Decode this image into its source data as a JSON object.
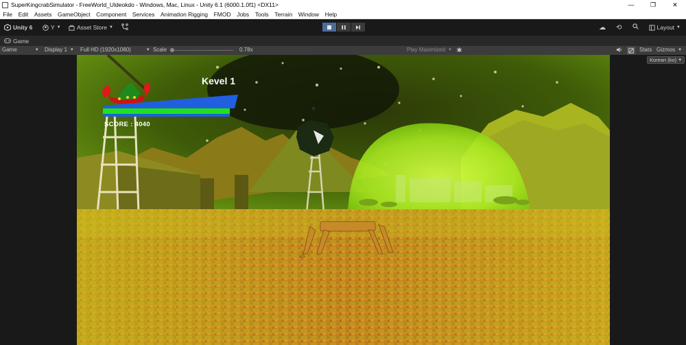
{
  "window": {
    "title": "SuperKingcrabSimulator - FreeWorld_Uldeokdo - Windows, Mac, Linux - Unity 6.1 (6000.1.0f1) <DX11>",
    "controls": {
      "minimize": "—",
      "maximize": "❐",
      "close": "✕"
    }
  },
  "menu": {
    "items": [
      "File",
      "Edit",
      "Assets",
      "GameObject",
      "Component",
      "Services",
      "Animation Rigging",
      "FMOD",
      "Jobs",
      "Tools",
      "Terrain",
      "Window",
      "Help"
    ]
  },
  "toolbar": {
    "unity_label": "Unity 6",
    "account_label": "Y",
    "asset_store_label": "Asset Store",
    "layout_label": "Layout"
  },
  "tab": {
    "label": "Game"
  },
  "gamebar": {
    "view_mode": "Game",
    "display": "Display 1",
    "resolution": "Full HD (1920x1080)",
    "scale_label": "Scale",
    "scale_value": "0.78x",
    "scale_fraction": 0.0,
    "play_mode": "Play Maximized",
    "stats_label": "Stats",
    "gizmos_label": "Gizmos"
  },
  "language_dropdown": {
    "value": "Korean (ko)"
  },
  "hud": {
    "level_text": "Kevel 1",
    "score_text": "SCORE : 4040"
  },
  "colors": {
    "editor_bg": "#191919",
    "toolbar_bg": "#3c3c3c",
    "play_active": "#4b6b9a",
    "health_bar_blue": "#1f5fe0",
    "health_bar_green": "#20e020"
  }
}
